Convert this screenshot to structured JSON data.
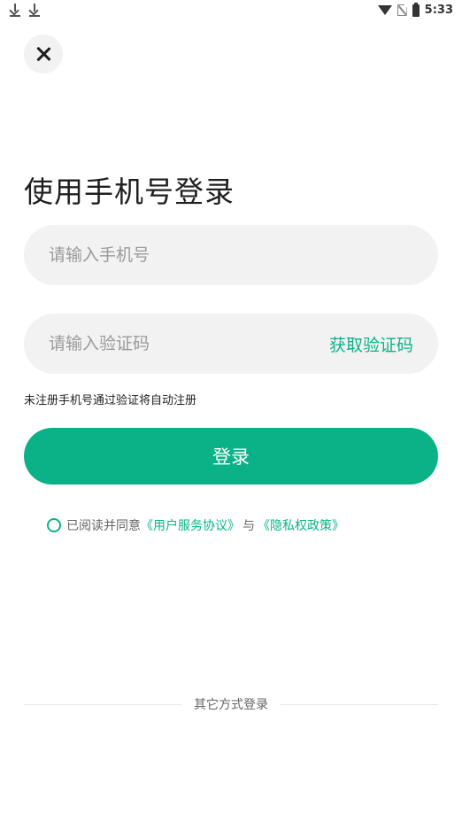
{
  "status_bar": {
    "time": "5:33",
    "left_icons": [
      "download-icon",
      "download-icon"
    ],
    "right_icons": [
      "wifi-icon",
      "no-sim-icon",
      "battery-icon"
    ]
  },
  "close_icon": "close-icon",
  "title": "使用手机号登录",
  "phone_input": {
    "placeholder": "请输入手机号",
    "value": ""
  },
  "code_input": {
    "placeholder": "请输入验证码",
    "value": ""
  },
  "get_code_label": "获取验证码",
  "hint": "未注册手机号通过验证将自动注册",
  "login_label": "登录",
  "agreement": {
    "prefix": "已阅读并同意",
    "user_agreement": "《用户服务协议》",
    "joiner": "与",
    "privacy_policy": "《隐私权政策》"
  },
  "other_login_label": "其它方式登录",
  "colors": {
    "accent": "#0bb287",
    "input_bg": "#f2f2f2"
  }
}
